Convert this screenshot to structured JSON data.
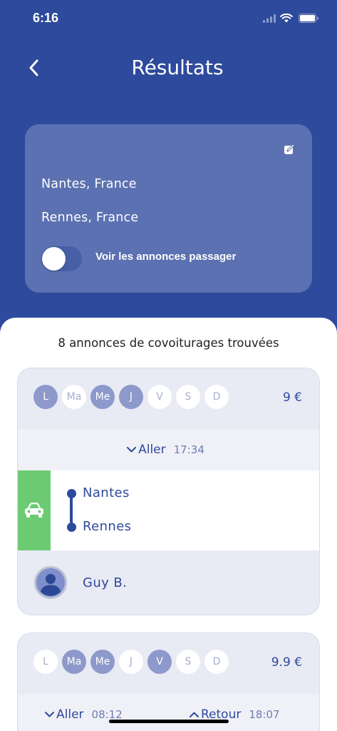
{
  "status_bar": {
    "time": "6:16",
    "icons": [
      "signal-icon",
      "wifi-icon",
      "battery-icon"
    ]
  },
  "header": {
    "title": "Résultats",
    "back_icon": "chevron-left-icon"
  },
  "search": {
    "departure": "Nantes, France",
    "arrival": "Rennes, France",
    "edit_icon": "edit-icon",
    "toggle_label": "Voir les annonces passager",
    "toggle_on": false
  },
  "results": {
    "count_text": "8 annonces de covoiturages trouvées",
    "cards": [
      {
        "days": [
          {
            "label": "L",
            "active": true
          },
          {
            "label": "Ma",
            "active": false
          },
          {
            "label": "Me",
            "active": true
          },
          {
            "label": "J",
            "active": true
          },
          {
            "label": "V",
            "active": false
          },
          {
            "label": "S",
            "active": false
          },
          {
            "label": "D",
            "active": false
          }
        ],
        "price": "9 €",
        "trips": [
          {
            "direction": "Aller",
            "time": "17:34",
            "icon": "chevron-down-icon"
          }
        ],
        "vehicle_icon": "car-icon",
        "route": {
          "from": "Nantes",
          "to": "Rennes"
        },
        "driver": {
          "name": "Guy B.",
          "avatar_icon": "user-icon"
        }
      },
      {
        "days": [
          {
            "label": "L",
            "active": false
          },
          {
            "label": "Ma",
            "active": true
          },
          {
            "label": "Me",
            "active": true
          },
          {
            "label": "J",
            "active": false
          },
          {
            "label": "V",
            "active": true
          },
          {
            "label": "S",
            "active": false
          },
          {
            "label": "D",
            "active": false
          }
        ],
        "price": "9.9 €",
        "trips": [
          {
            "direction": "Aller",
            "time": "08:12",
            "icon": "chevron-down-icon"
          },
          {
            "direction": "Retour",
            "time": "18:07",
            "icon": "chevron-up-icon"
          }
        ]
      }
    ]
  },
  "colors": {
    "primary": "#2E4A9C",
    "green": "#6CCB72",
    "day_active": "#8D99CA",
    "day_inactive_text": "#A7AED0",
    "time_text": "#6F7CB2"
  }
}
